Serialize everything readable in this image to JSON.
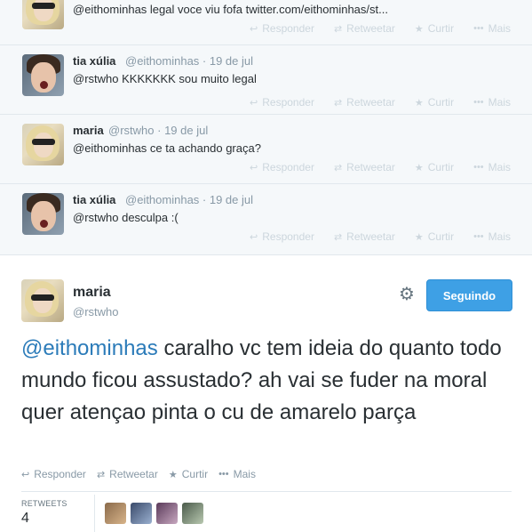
{
  "replies": [
    {
      "name": "",
      "handle": "",
      "date": "",
      "text": "@eithominhas legal voce viu fofa twitter.com/eithominhas/st...",
      "avatar": "maria-avatar"
    },
    {
      "name": "tia xúlia",
      "handle": "@eithominhas",
      "date": "· 19 de jul",
      "text": "@rstwho KKKKKKK sou muito legal",
      "avatar": "tia-avatar"
    },
    {
      "name": "maria",
      "handle": "@rstwho",
      "date": "· 19 de jul",
      "text": "@eithominhas ce ta achando graça?",
      "avatar": "maria-avatar"
    },
    {
      "name": "tia xúlia",
      "handle": "@eithominhas",
      "date": "· 19 de jul",
      "text": "@rstwho desculpa :(",
      "avatar": "tia-avatar"
    }
  ],
  "actions": {
    "reply": "Responder",
    "retweet": "Retweetar",
    "favorite": "Curtir",
    "more": "Mais"
  },
  "main_tweet": {
    "name": "maria",
    "handle": "@rstwho",
    "follow_label": "Seguindo",
    "mention": "@eithominhas",
    "text_rest": " caralho vc tem ideia do quanto todo mundo ficou assustado? ah vai se fuder na moral quer atençao pinta o cu de amarelo parça"
  },
  "stats": {
    "retweets_label": "RETWEETS",
    "retweets_count": "4"
  },
  "colors": {
    "accent": "#3ea0e5",
    "link": "#2b7bb9",
    "muted": "#8899a6",
    "reply_bg": "#f5f8fa"
  }
}
